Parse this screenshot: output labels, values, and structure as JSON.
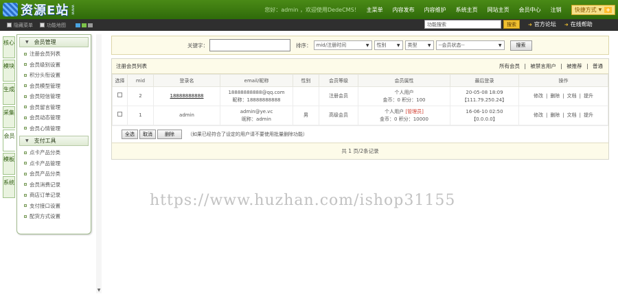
{
  "header": {
    "logo_text": "资源E站",
    "logo_small": "www",
    "greeting": "您好：admin ，欢迎使用DedeCMS！",
    "nav": [
      "主菜单",
      "内容发布",
      "内容维护",
      "系统主页",
      "网站主页",
      "会员中心",
      "注销"
    ],
    "quick_label": "快捷方式",
    "quick_plus": "+"
  },
  "subbar": {
    "hide_menu": "隐藏菜单",
    "func_map": "功能地图",
    "search_placeholder": "功能搜索",
    "search_btn": "搜索",
    "forum": "官方论坛",
    "help": "在线帮助",
    "colors": [
      "#4aa3df",
      "#7cc24a",
      "#999999"
    ]
  },
  "lefttabs": [
    {
      "label": "核心"
    },
    {
      "label": "模块"
    },
    {
      "label": "生成"
    },
    {
      "label": "采集"
    },
    {
      "label": "会员",
      "active": true
    },
    {
      "label": "模板"
    },
    {
      "label": "系统"
    }
  ],
  "sidebar": {
    "section1": "会员管理",
    "items1": [
      "注册会员列表",
      "会员级别设置",
      "积分头衔设置",
      "会员模型管理",
      "会员短信管理",
      "会员留言管理",
      "会员动态管理",
      "会员心情管理"
    ],
    "section2": "支付工具",
    "items2": [
      "点卡产品分类",
      "点卡产品管理",
      "会员产品分类",
      "会员消费记录",
      "商店订单记录",
      "支付接口设置",
      "配货方式设置"
    ]
  },
  "filter": {
    "keyword_label": "关键字：",
    "sort_label": "排序：",
    "sort_value": "mid/注册时间",
    "gender_value": "性别",
    "type_value": "类型",
    "status_value": "--会员状态--",
    "search_btn": "搜索"
  },
  "table": {
    "title": "注册会员列表",
    "tabs": [
      "所有会员",
      "被禁言用户",
      "被推荐",
      "普通"
    ],
    "tab_sep": "|",
    "columns": [
      "选择",
      "mid",
      "登录名",
      "email/昵称",
      "性别",
      "会员等级",
      "会员属性",
      "最后登录",
      "操作"
    ],
    "rows": [
      {
        "mid": "2",
        "login": "18888888888",
        "email": "18888888888@qq.com",
        "nick": "昵称：18888888888",
        "gender": "",
        "level": "注册会员",
        "attr1": "个人用户",
        "attr_tag": "",
        "attr2": "金币：0 积分：100",
        "last1": "20-05-08 18:09",
        "last2": "【111.79.250.24】",
        "actions": [
          "修改",
          "删除",
          "文档",
          "提升"
        ]
      },
      {
        "mid": "1",
        "login": "admin",
        "email": "admin@ye.vc",
        "nick": "昵称：admin",
        "gender": "男",
        "level": "高级会员",
        "attr1": "个人用户",
        "attr_tag": "[管理员]",
        "attr2": "金币：0 积分：10000",
        "last1": "16-06-10 02:50",
        "last2": "【0.0.0.0】",
        "actions": [
          "修改",
          "删除",
          "文档",
          "提升"
        ]
      }
    ],
    "btn_all": "全选",
    "btn_cancel": "取消",
    "btn_delete": "删除",
    "note": "（如果已经符合了设定的用户请不要使用批量删除功能）",
    "pager": "共 1 页/2条记录"
  },
  "watermark": "https://www.huzhan.com/ishop31155"
}
